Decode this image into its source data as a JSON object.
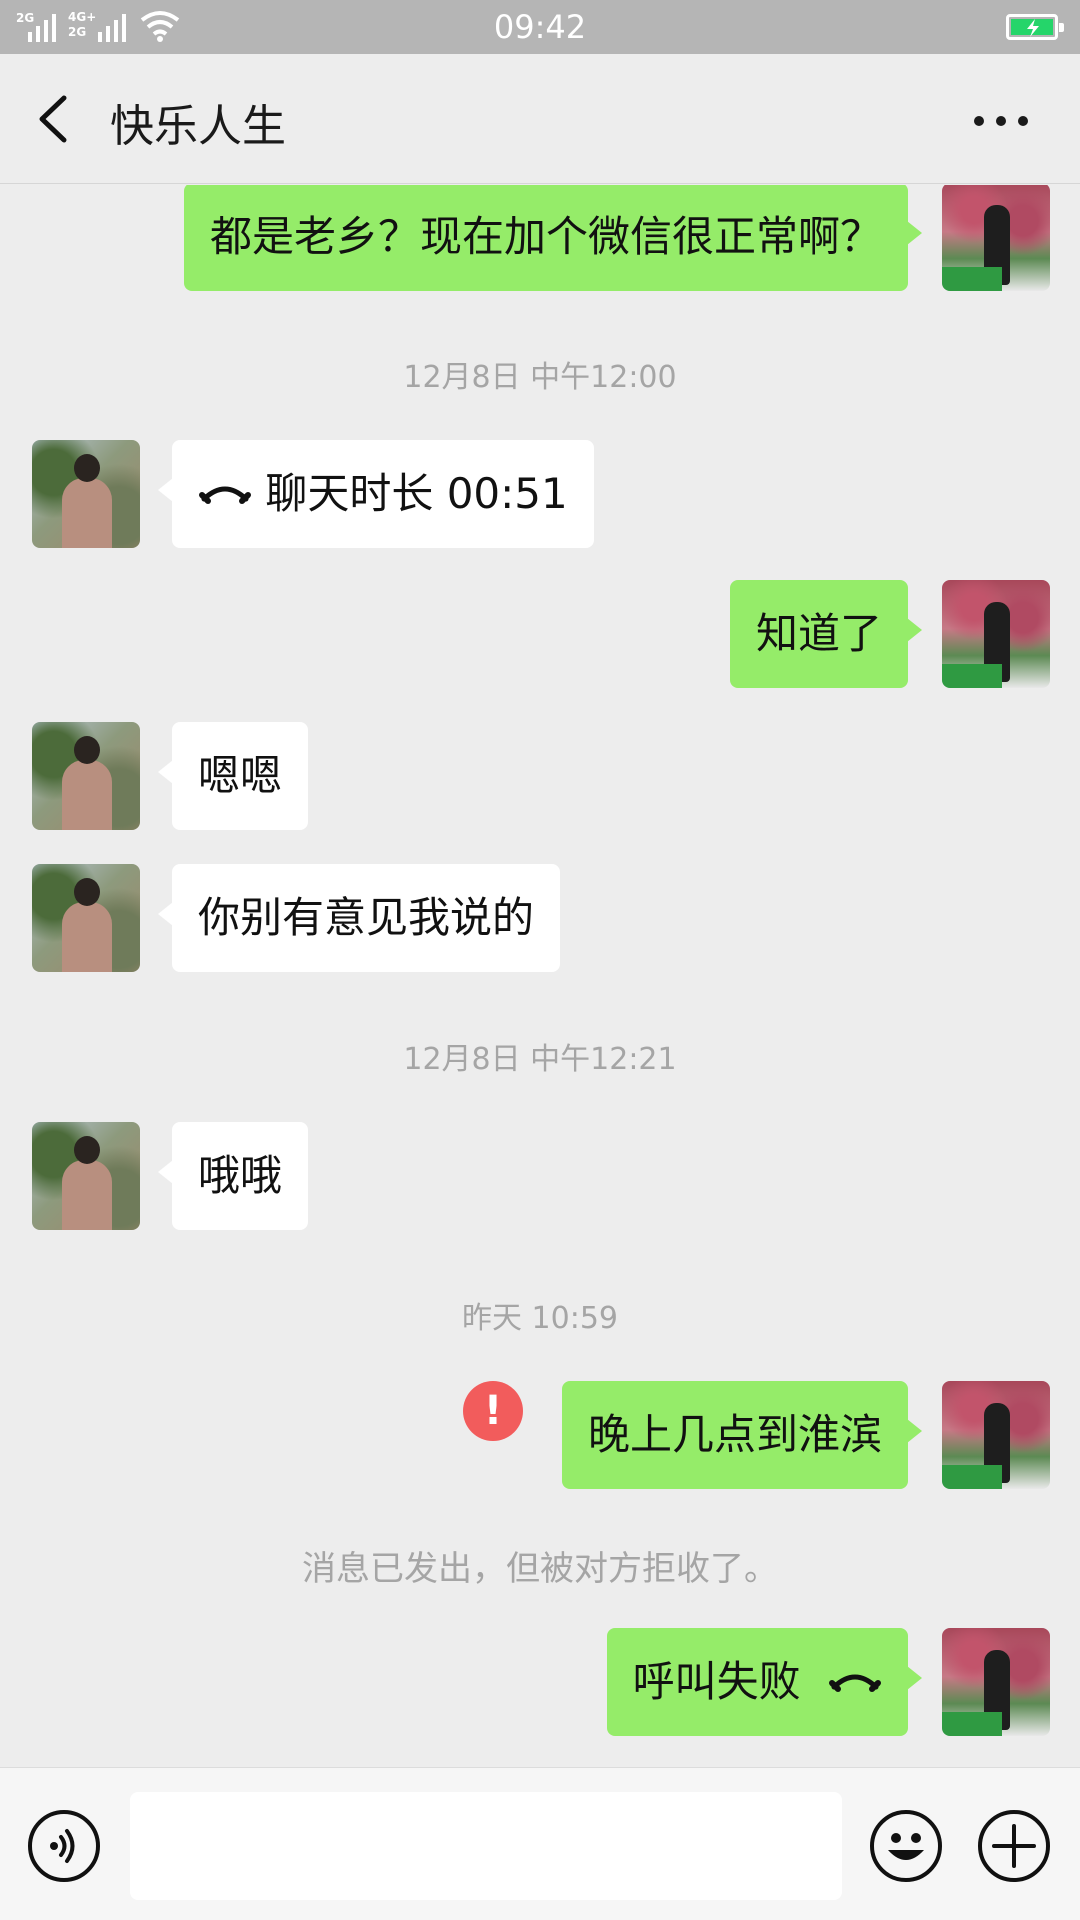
{
  "status_bar": {
    "time": "09:42",
    "signal1_label": "2G",
    "signal2_label_top": "4G+",
    "signal2_label_bottom": "2G"
  },
  "header": {
    "title": "快乐人生",
    "back_icon": "chevron-left-icon",
    "more_icon": "more-dots-icon"
  },
  "messages": [
    {
      "side": "me",
      "text": "都是老乡？现在加个微信很正常啊？"
    },
    {
      "type": "timestamp",
      "text": "12月8日 中午12:00"
    },
    {
      "side": "other",
      "text": "聊天时长 00:51",
      "icon": "phone-hangup-icon"
    },
    {
      "side": "me",
      "text": "知道了"
    },
    {
      "side": "other",
      "text": "嗯嗯"
    },
    {
      "side": "other",
      "text": "你别有意见我说的"
    },
    {
      "type": "timestamp",
      "text": "12月8日 中午12:21"
    },
    {
      "side": "other",
      "text": "哦哦"
    },
    {
      "type": "timestamp",
      "text": "昨天 10:59"
    },
    {
      "side": "me",
      "text": "晚上几点到淮滨",
      "status": "failed",
      "status_mark": "!"
    },
    {
      "type": "system",
      "text": "消息已发出，但被对方拒收了。"
    },
    {
      "side": "me",
      "text": "呼叫失败",
      "icon": "phone-hangup-icon"
    }
  ],
  "input_bar": {
    "voice_icon": "voice-icon",
    "text_value": "",
    "emoji_icon": "emoji-icon",
    "add_icon": "plus-icon"
  },
  "colors": {
    "my_bubble": "#95ec69",
    "other_bubble": "#ffffff",
    "background": "#ededed",
    "error": "#f25c5c",
    "timestamp": "#a5a5a5"
  }
}
